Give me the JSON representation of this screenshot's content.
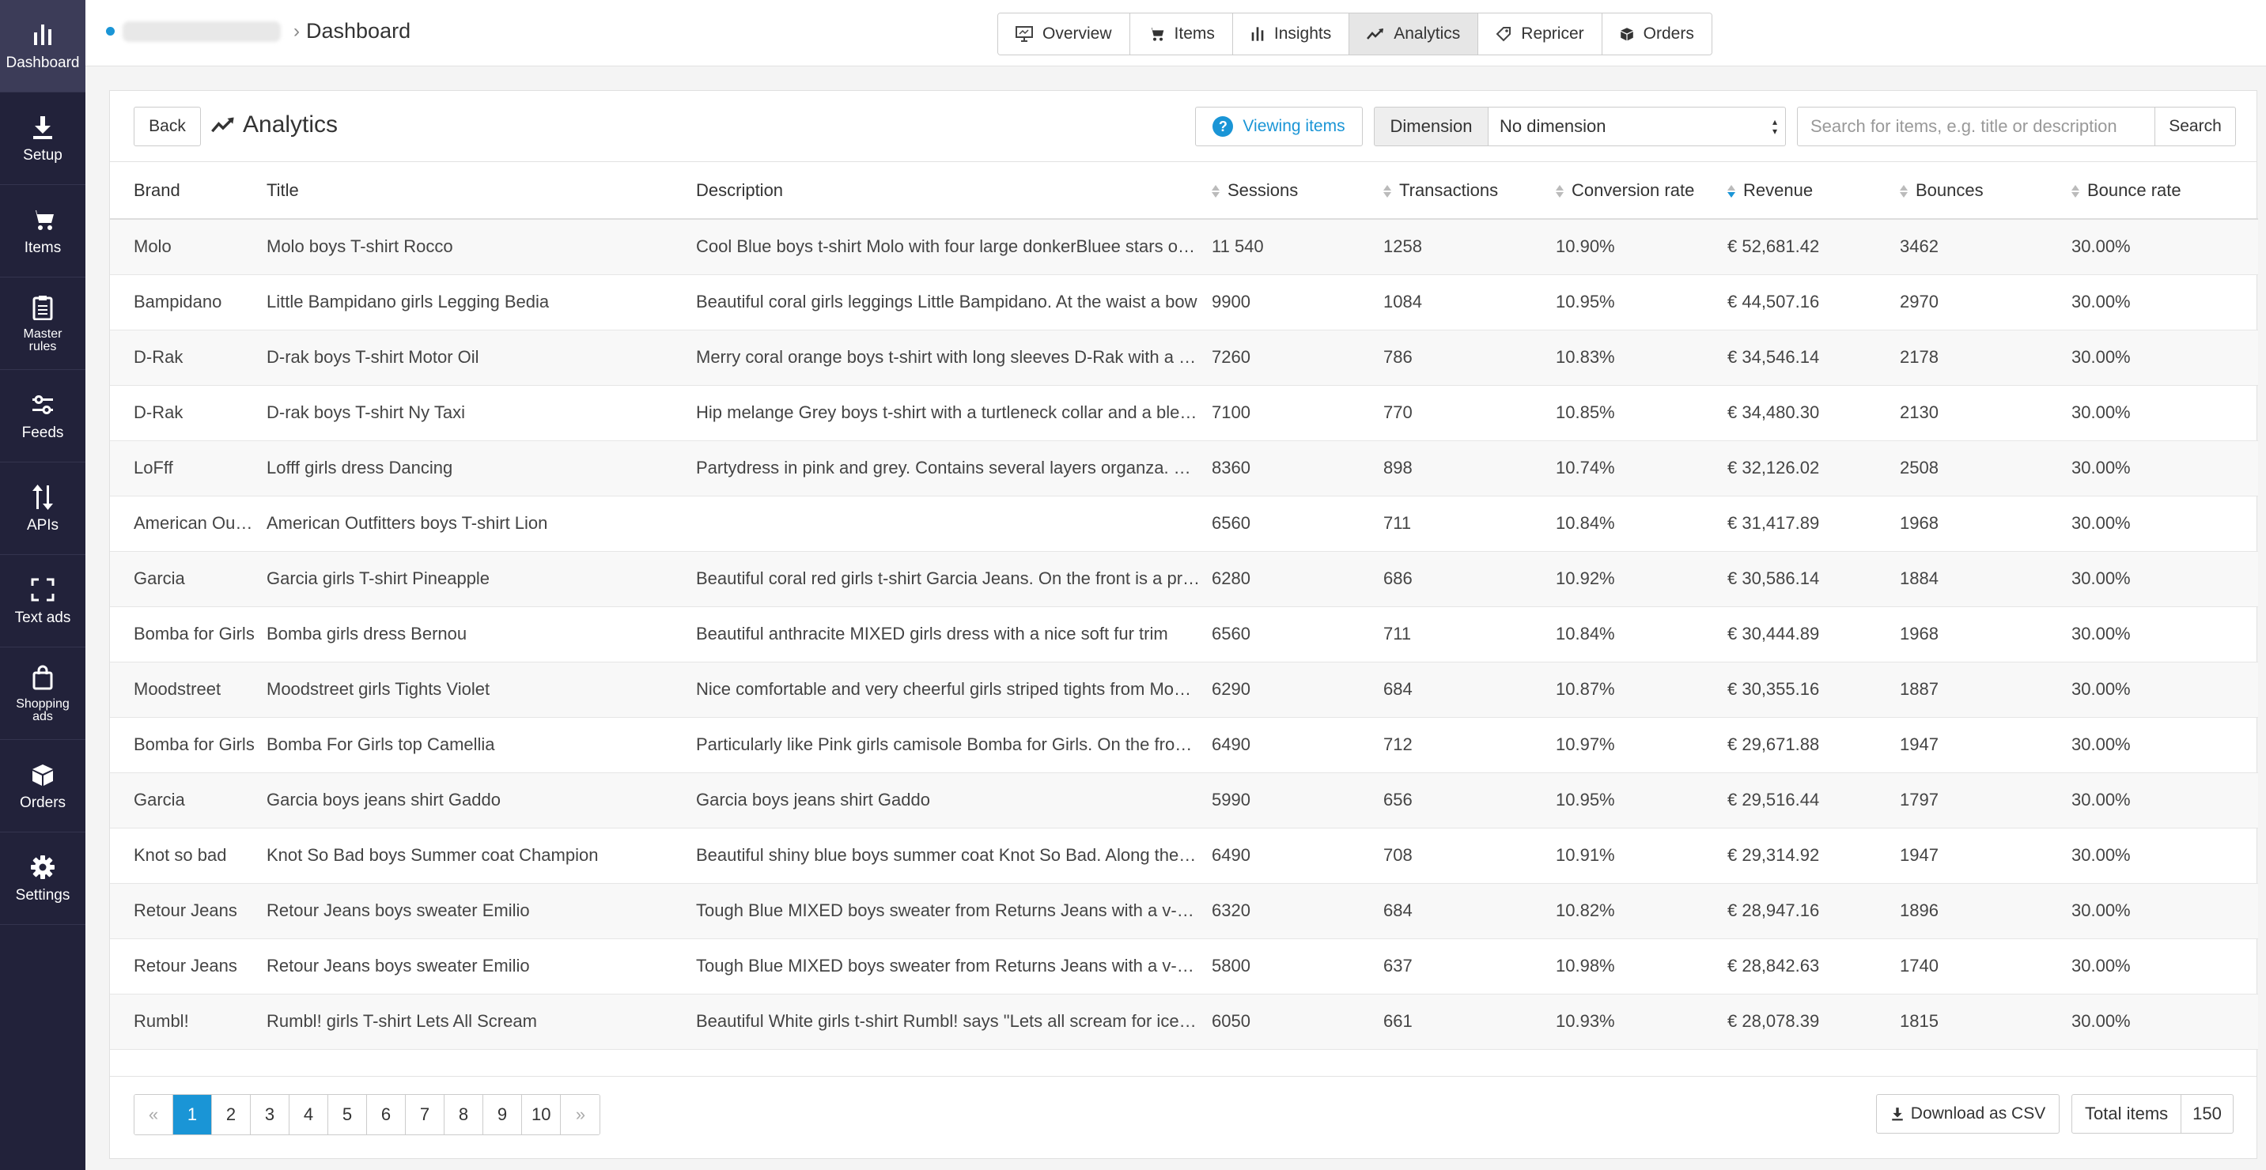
{
  "sidebar": {
    "items": [
      {
        "label": "Dashboard",
        "icon": "bar-chart-icon"
      },
      {
        "label": "Setup",
        "icon": "download-icon"
      },
      {
        "label": "Items",
        "icon": "cart-icon"
      },
      {
        "label": "Master rules",
        "icon": "clipboard-icon"
      },
      {
        "label": "Feeds",
        "icon": "sliders-icon"
      },
      {
        "label": "APIs",
        "icon": "arrows-updown-icon"
      },
      {
        "label": "Text ads",
        "icon": "expand-icon"
      },
      {
        "label": "Shopping ads",
        "icon": "bag-icon"
      },
      {
        "label": "Orders",
        "icon": "box-icon"
      },
      {
        "label": "Settings",
        "icon": "gear-icon"
      }
    ]
  },
  "header": {
    "breadcrumb_current": "Dashboard",
    "tabs": [
      {
        "label": "Overview",
        "icon": "presentation-icon"
      },
      {
        "label": "Items",
        "icon": "cart-icon"
      },
      {
        "label": "Insights",
        "icon": "bar-chart-icon"
      },
      {
        "label": "Analytics",
        "icon": "line-chart-icon"
      },
      {
        "label": "Repricer",
        "icon": "tag-icon"
      },
      {
        "label": "Orders",
        "icon": "box-icon"
      }
    ]
  },
  "panel": {
    "back_label": "Back",
    "title": "Analytics",
    "viewing_label": "Viewing items",
    "dimension_label": "Dimension",
    "dimension_value": "No dimension",
    "search_placeholder": "Search for items, e.g. title or description",
    "search_button": "Search"
  },
  "table": {
    "columns": [
      "Brand",
      "Title",
      "Description",
      "Sessions",
      "Transactions",
      "Conversion rate",
      "Revenue",
      "Bounces",
      "Bounce rate"
    ],
    "rows": [
      [
        "Molo",
        "Molo boys T-shirt Rocco",
        "Cool Blue boys t-shirt Molo with four large donkerBluee stars on the front",
        "11 540",
        "1258",
        "10.90%",
        "€ 52,681.42",
        "3462",
        "30.00%"
      ],
      [
        "Bampidano",
        "Little Bampidano girls Legging Bedia",
        "Beautiful coral girls leggings Little Bampidano. At the waist a bow",
        "9900",
        "1084",
        "10.95%",
        "€ 44,507.16",
        "2970",
        "30.00%"
      ],
      [
        "D-Rak",
        "D-rak boys T-shirt Motor Oil",
        "Merry coral orange boys t-shirt with long sleeves D-Rak with a print",
        "7260",
        "786",
        "10.83%",
        "€ 34,546.14",
        "2178",
        "30.00%"
      ],
      [
        "D-Rak",
        "D-rak boys T-shirt Ny Taxi",
        "Hip melange Grey boys t-shirt with a turtleneck collar and a bleached print",
        "7100",
        "770",
        "10.85%",
        "€ 34,480.30",
        "2130",
        "30.00%"
      ],
      [
        "LoFff",
        "Lofff girls dress Dancing",
        "Partydress in pink and grey. Contains several layers organza. With lining",
        "8360",
        "898",
        "10.74%",
        "€ 32,126.02",
        "2508",
        "30.00%"
      ],
      [
        "American Outfitters",
        "American Outfitters boys T-shirt Lion",
        "",
        "6560",
        "711",
        "10.84%",
        "€ 31,417.89",
        "1968",
        "30.00%"
      ],
      [
        "Garcia",
        "Garcia girls T-shirt Pineapple",
        "Beautiful coral red girls t-shirt Garcia Jeans. On the front is a print",
        "6280",
        "686",
        "10.92%",
        "€ 30,586.14",
        "1884",
        "30.00%"
      ],
      [
        "Bomba for Girls",
        "Bomba girls dress Bernou",
        "Beautiful anthracite MIXED girls dress with a nice soft fur trim",
        "6560",
        "711",
        "10.84%",
        "€ 30,444.89",
        "1968",
        "30.00%"
      ],
      [
        "Moodstreet",
        "Moodstreet girls Tights Violet",
        "Nice comfortable and very cheerful girls striped tights from Moodstreet",
        "6290",
        "684",
        "10.87%",
        "€ 30,355.16",
        "1887",
        "30.00%"
      ],
      [
        "Bomba for Girls",
        "Bomba For Girls top Camellia",
        "Particularly like Pink girls camisole Bomba for Girls. On the front a print",
        "6490",
        "712",
        "10.97%",
        "€ 29,671.88",
        "1947",
        "30.00%"
      ],
      [
        "Garcia",
        "Garcia boys jeans shirt Gaddo",
        "Garcia boys jeans shirt Gaddo",
        "5990",
        "656",
        "10.95%",
        "€ 29,516.44",
        "1797",
        "30.00%"
      ],
      [
        "Knot so bad",
        "Knot So Bad boys Summer coat Champion",
        "Beautiful shiny blue boys summer coat Knot So Bad. Along the front a zipper",
        "6490",
        "708",
        "10.91%",
        "€ 29,314.92",
        "1947",
        "30.00%"
      ],
      [
        "Retour Jeans",
        "Retour Jeans boys sweater Emilio",
        "Tough Blue MIXED boys sweater from Returns Jeans with a v-neck",
        "6320",
        "684",
        "10.82%",
        "€ 28,947.16",
        "1896",
        "30.00%"
      ],
      [
        "Retour Jeans",
        "Retour Jeans boys sweater Emilio",
        "Tough Blue MIXED boys sweater from Returns Jeans with a v-neck",
        "5800",
        "637",
        "10.98%",
        "€ 28,842.63",
        "1740",
        "30.00%"
      ],
      [
        "Rumbl!",
        "Rumbl! girls T-shirt Lets All Scream",
        "Beautiful White girls t-shirt Rumbl! says \"Lets all scream for ice cream\"",
        "6050",
        "661",
        "10.93%",
        "€ 28,078.39",
        "1815",
        "30.00%"
      ]
    ]
  },
  "footer": {
    "pages": [
      "«",
      "1",
      "2",
      "3",
      "4",
      "5",
      "6",
      "7",
      "8",
      "9",
      "10",
      "»"
    ],
    "current_page": "1",
    "csv_label": "Download as CSV",
    "total_label": "Total items",
    "total_value": "150"
  },
  "colors": {
    "sidebar_bg": "#22223a",
    "accent": "#1a95d6"
  }
}
